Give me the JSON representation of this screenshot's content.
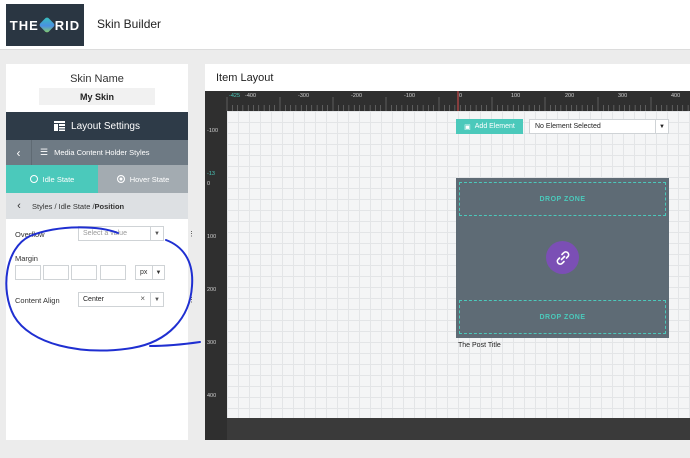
{
  "app": {
    "logo_text_left": "THE",
    "logo_text_right": "RID",
    "title": "Skin Builder"
  },
  "left_panel": {
    "skin_name_label": "Skin Name",
    "skin_name_value": "My Skin",
    "layout_settings_label": "Layout Settings",
    "section_label": "Media Content Holder Styles",
    "tabs": [
      {
        "label": "Idle State",
        "active": true
      },
      {
        "label": "Hover State",
        "active": false
      }
    ],
    "breadcrumb_prefix": "Styles / Idle State / ",
    "breadcrumb_current": "Position",
    "overflow": {
      "label": "Overflow",
      "placeholder": "Select a value"
    },
    "margin": {
      "label": "Margin",
      "unit": "px"
    },
    "content_align": {
      "label": "Content Align",
      "value": "Center",
      "clear": "×"
    }
  },
  "right_panel": {
    "title": "Item Layout",
    "add_element_label": "Add Element",
    "element_select_value": "No Element Selected",
    "drop_zone_top": "DROP ZONE",
    "drop_zone_bottom": "DROP ZONE",
    "post_title": "The Post Title",
    "ruler_top": [
      "-425",
      "-400",
      "-300",
      "-200",
      "-100",
      "0",
      "100",
      "200",
      "300",
      "400"
    ],
    "ruler_left": [
      "-100",
      "-13",
      "0",
      "100",
      "200",
      "300",
      "400"
    ]
  },
  "colors": {
    "accent": "#4bc9bb",
    "dark_header": "#2e3b48",
    "link_button": "#7b4fb5",
    "annotation": "#1f2fd1"
  }
}
